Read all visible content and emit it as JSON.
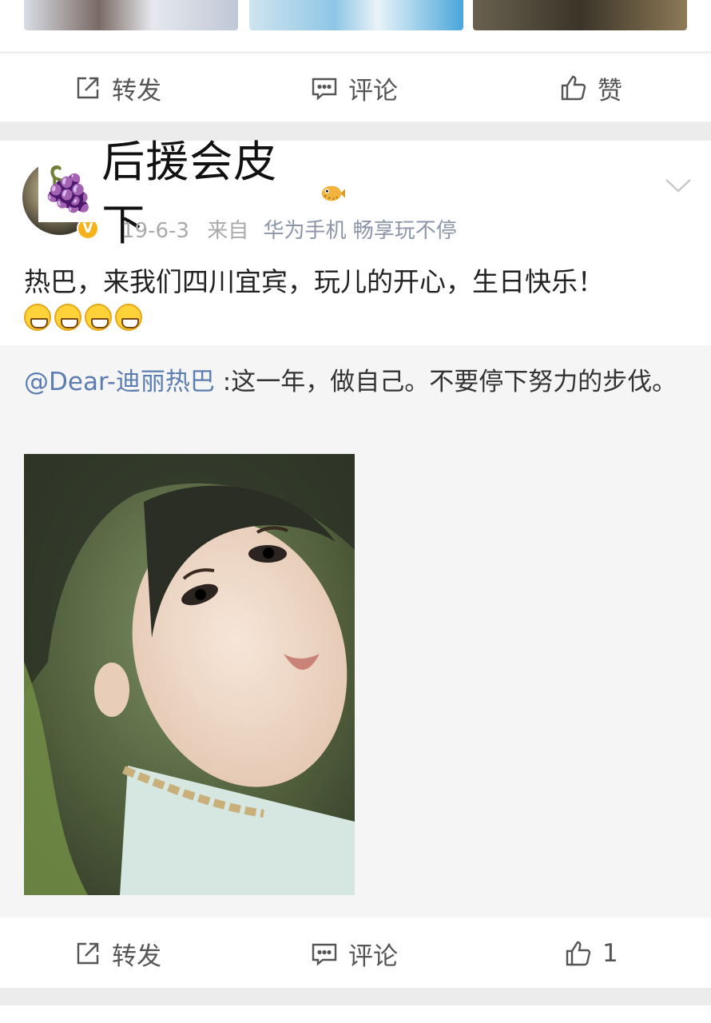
{
  "feed": {
    "previous_post": {
      "actions": {
        "repost_label": "转发",
        "comment_label": "评论",
        "like_label": "赞"
      }
    },
    "post": {
      "author_name": "后援会皮下",
      "author_emoji": "🍇",
      "timestamp": "19-6-3",
      "source_prefix": "来自",
      "source": "华为手机 畅享玩不停",
      "text": "热巴，来我们四川宜宾，玩儿的开心，生日快乐！",
      "emoji_count": 4,
      "repost": {
        "mention": "@Dear-迪丽热巴",
        "text": " :这一年，做自己。不要停下努力的步伐。"
      },
      "actions": {
        "repost_label": "转发",
        "comment_label": "评论",
        "like_count": "1"
      }
    }
  },
  "icons": {
    "repost": "share-icon",
    "comment": "comment-icon",
    "like": "thumbs-up-icon",
    "more": "chevron-down-icon",
    "verified": "verified-badge-icon"
  },
  "colors": {
    "mention": "#5b7db1",
    "verified_badge": "#f5b21b"
  }
}
